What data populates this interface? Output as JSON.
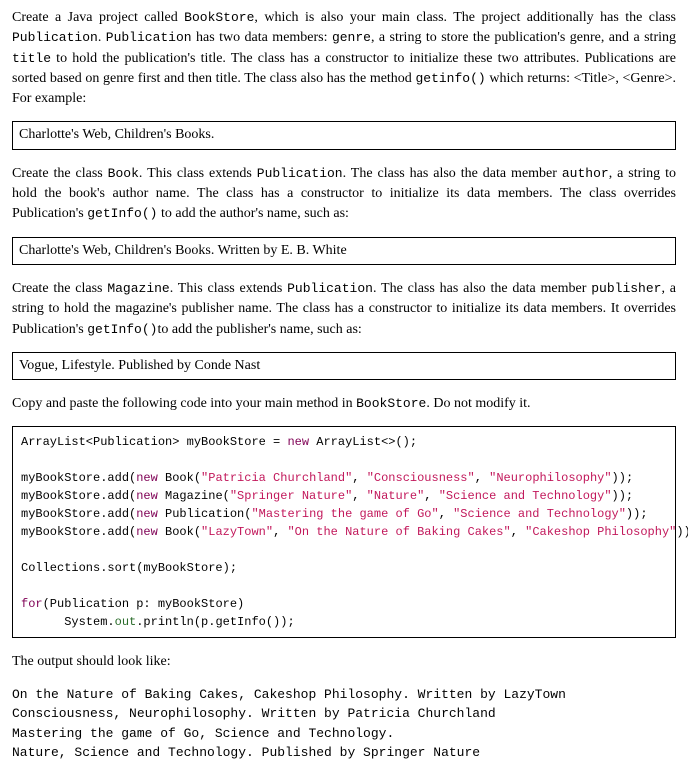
{
  "para1": {
    "t1": "Create a Java project called ",
    "c1": "BookStore",
    "t2": ", which is also your main class. The project additionally has the class ",
    "c2": "Publication",
    "t3": ". ",
    "c3": "Publication",
    "t4": " has two data members: ",
    "c4": "genre",
    "t5": ", a string to store the publication's genre, and a string ",
    "c5": "title",
    "t6": " to hold the publication's title. The class has a constructor to initialize these two attributes. Publications are sorted based on genre first and then title. The class also has the method ",
    "c6": "getinfo()",
    "t7": " which returns: <Title>, <Genre>. For example:"
  },
  "box1": "Charlotte's Web, Children's Books.",
  "para2": {
    "t1": "Create the class ",
    "c1": "Book",
    "t2": ". This class extends ",
    "c2": "Publication",
    "t3": ".  The class has also the data member ",
    "c3": "author",
    "t4": ", a string to hold the book's author name.  The class has a constructor to initialize its data members. The class overrides Publication's ",
    "c4": "getInfo()",
    "t5": " to add the author's name, such as:"
  },
  "box2": "Charlotte's Web, Children's Books. Written by E. B. White",
  "para3": {
    "t1": "Create the class ",
    "c1": "Magazine",
    "t2": ". This class extends ",
    "c2": "Publication",
    "t3": ".   The class has also the data member ",
    "c3": "publisher",
    "t4": ", a string to hold the magazine's publisher name. The class has a constructor to initialize its data members. It overrides Publication's ",
    "c4": "getInfo()",
    "t5": "to add the publisher's name, such as:"
  },
  "box3": "Vogue, Lifestyle. Published by Conde Nast",
  "para4": {
    "t1": "Copy and paste the following code into your main method in ",
    "c1": "BookStore",
    "t2": ". Do not modify it."
  },
  "code": {
    "l1a": "ArrayList<Publication> myBookStore = ",
    "l1k": "new",
    "l1b": " ArrayList<>();",
    "blank": "",
    "l2a": "myBookStore.add(",
    "l2k": "new",
    "l2b": " Book(",
    "l2s1": "\"Patricia Churchland\"",
    "l2c": ", ",
    "l2s2": "\"Consciousness\"",
    "l2d": ", ",
    "l2s3": "\"Neurophilosophy\"",
    "l2e": "));",
    "l3a": "myBookStore.add(",
    "l3k": "new",
    "l3b": " Magazine(",
    "l3s1": "\"Springer Nature\"",
    "l3c": ", ",
    "l3s2": "\"Nature\"",
    "l3d": ", ",
    "l3s3": "\"Science and Technology\"",
    "l3e": "));",
    "l4a": "myBookStore.add(",
    "l4k": "new",
    "l4b": " Publication(",
    "l4s1": "\"Mastering the game of Go\"",
    "l4c": ", ",
    "l4s2": "\"Science and Technology\"",
    "l4d": "));",
    "l5a": "myBookStore.add(",
    "l5k": "new",
    "l5b": " Book(",
    "l5s1": "\"LazyTown\"",
    "l5c": ", ",
    "l5s2": "\"On the Nature of Baking Cakes\"",
    "l5d": ", ",
    "l5s3": "\"Cakeshop Philosophy\"",
    "l5e": "));",
    "l6": "Collections.sort(myBookStore);",
    "l7k": "for",
    "l7a": "(Publication p: myBookStore)",
    "l8a": "      System.",
    "l8o": "out",
    "l8b": ".println(p.getInfo());"
  },
  "para5": "The output should look like:",
  "output": {
    "l1": "On the Nature of Baking Cakes, Cakeshop Philosophy. Written by LazyTown",
    "l2": "Consciousness, Neurophilosophy. Written by Patricia Churchland",
    "l3": "Mastering the game of Go, Science and Technology.",
    "l4": "Nature, Science and Technology. Published by Springer Nature"
  }
}
